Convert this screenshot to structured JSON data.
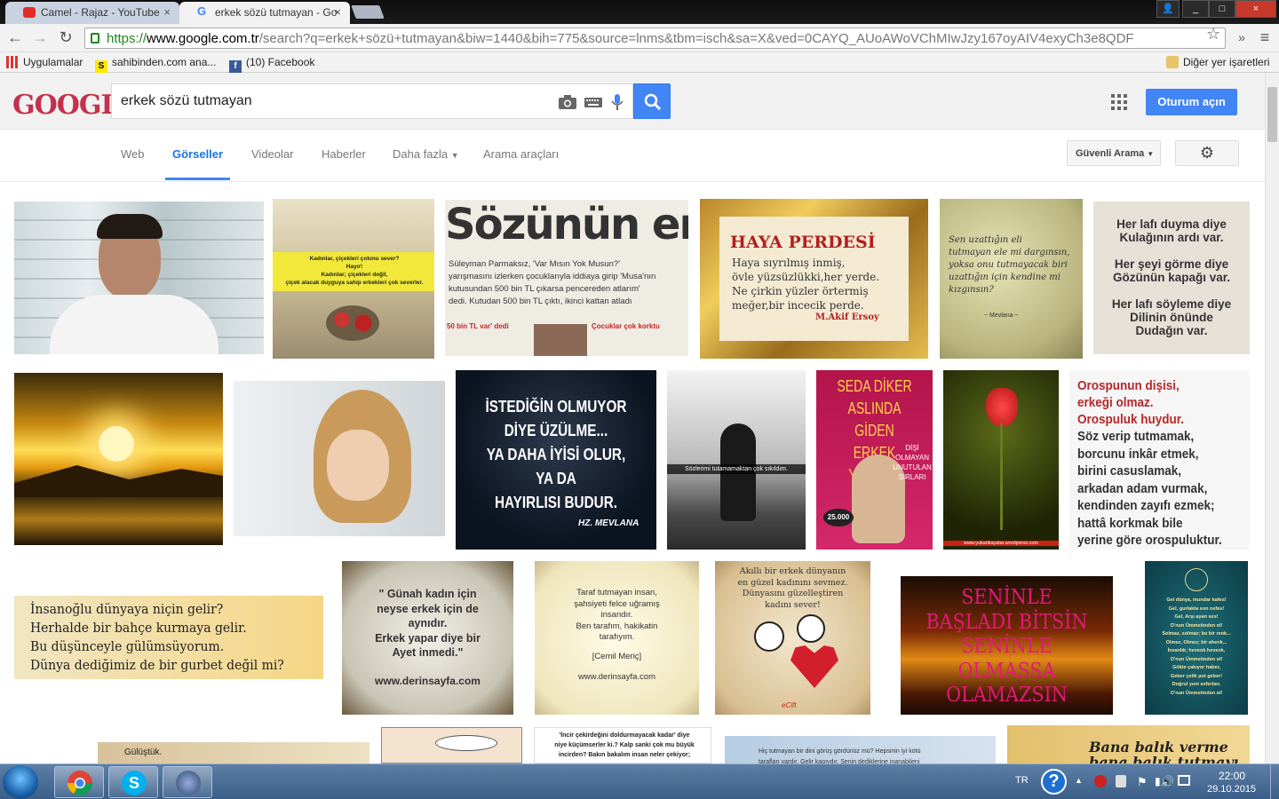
{
  "browser": {
    "tabs": [
      {
        "title": "Camel - Rajaz - YouTube",
        "close": "×"
      },
      {
        "title": "erkek sözü tutmayan - Go",
        "close": "×"
      }
    ],
    "url": {
      "scheme": "https://",
      "host": "www.google.com.tr",
      "rest": "/search?q=erkek+sözü+tutmayan&biw=1440&bih=775&source=lnms&tbm=isch&sa=X&ved=0CAYQ_AUoAWoVChMIwJzy167oyAIV4exyCh3e8QDF"
    },
    "menu_chevrons": "»",
    "menu_icon": "≡",
    "window_controls": {
      "user": "👤",
      "minimize": "_",
      "maximize": "□",
      "close": "×"
    }
  },
  "bookmarks": {
    "items": [
      {
        "label": "Uygulamalar",
        "icon": "apps-grid-icon"
      },
      {
        "label": "sahibinden.com ana...",
        "icon_letter": "S"
      },
      {
        "label": "(10) Facebook",
        "icon_letter": "f"
      }
    ],
    "other": "Diğer yer işaretleri"
  },
  "google": {
    "logo": "GOOGLE",
    "query": "erkek sözü tutmayan",
    "signin": "Oturum açın",
    "tabs": [
      "Web",
      "Görseller",
      "Videolar",
      "Haberler",
      "Daha fazla",
      "Arama araçları"
    ],
    "active_tab": "Görseller",
    "safesearch": "Güvenli Arama"
  },
  "images": {
    "r1": [
      {
        "text": "",
        "kind": "photo-man"
      },
      {
        "text": "Kadınlar, çiçekleri çokmu sever?\nHayır!\nKadınlar; çiçekleri değil,\nçiçek alacak duyguya sahip erkekleri çok severler."
      },
      {
        "text": "Sözünün eri",
        "sub": "Süleyman Parmaksız, 'Var Mısın Yok Musun?'\nyarışmasını izlerken çocuklarıyla iddiaya girip 'Musa'nın\nkutusundan 500 bin TL çıkarsa pencereden atlarım'\ndedi. Kutudan 500 bin TL çıktı, ikinci kattan atladı",
        "foot1": "50 bin TL var' dedi",
        "foot2": "Çocuklar çok korktu"
      },
      {
        "text": "HAYA PERDESİ",
        "sub": "Haya sıyrılmış inmiş,\növle yüzsüzlükki,her yerde.\nNe çirkin yüzler örtermiş\nmeğer,bir incecik perde.",
        "foot1": "M.Akif Ersoy"
      },
      {
        "text": "Sen uzattığın eli\ntutmayan ele mi dargınsın,\nyoksa onu tutmayacak biri\nuzattığın için kendine mi\nkızgınsın?",
        "foot1": "~ Mevlana ~"
      },
      {
        "text": "Her lafı duyma diye\nKulağının ardı var.\n\nHer şeyi görme diye\nGözünün kapağı var.\n\nHer lafı söyleme diye\nDilinin önünde\nDudağın var."
      }
    ],
    "r2": [
      {
        "text": "",
        "kind": "sunset"
      },
      {
        "text": "",
        "kind": "girl"
      },
      {
        "text": "İSTEDİĞİN OLMUYOR\nDİYE ÜZÜLME...\nYA DAHA İYİSİ OLUR,\nYA DA\nHAYIRLISI BUDUR.",
        "foot1": "HZ. MEVLANA"
      },
      {
        "text": "Sözlerimi tutamamaktan çok sıkıldım."
      },
      {
        "text": "SEDA DİKER\nASLINDA GİDEN\nERKEK YOKTUR",
        "sub": "DİŞİ\nOLMAYAN\nUNUTULAN\nSIRLARI",
        "foot1": "25.000"
      },
      {
        "text": "",
        "kind": "tulip",
        "foot1": "www.yukarikayalar.wordpress.com"
      },
      {
        "text": "Orospunun dişisi,\nerkeği olmaz.\nOrospuluk huydur.",
        "sub": "Söz verip tutmamak,\nborcunu inkâr etmek,\nbirini casuslamak,\narkadan adam vurmak,\nkendinden zayıfı ezmek;\nhattâ korkmak bile\nyerine göre orospuluktur."
      }
    ],
    "r3": [
      {
        "text": "İnsanoğlu dünyaya niçin gelir?\nHerhalde bir bahçe kurmaya gelir.\nBu düşünceyle gülümsüyorum.\nDünya dediğimiz de bir gurbet değil mi?"
      },
      {
        "text": "\" Günah kadın için\nneyse erkek için de\naynıdır.\nErkek yapar diye bir\nAyet inmedi.\"",
        "foot1": "www.derinsayfa.com"
      },
      {
        "text": "Taraf tutmayan insan,\nşahsiyeti felce uğramış\ninsandır.\nBen tarafım, hakikatin\ntarafıyım.",
        "sub": "[Cemil Meriç]",
        "foot1": "www.derinsayfa.com"
      },
      {
        "text": "Akıllı bir erkek dünyanın\nen güzel kadınını sevmez.\nDünyasını güzelleştiren\nkadını sever!",
        "foot1": "eCift"
      },
      {
        "text": "SENİNLE\nBAŞLADI BİTSİN\nSENİNLE\nOLMASSA\nOLAMAZSIN"
      },
      {
        "text": "Gel dünya, mundar kafes!\nGel, gurlakta son nefes!\nGel, Arşı ayan ses!\nO'nun Ümmetinden ol!\nSolmaz, solmaz; bu bir renk...\nOlmez, Olmez; bir ahenk...\nİnsanlık; hevenk hevenk,\nO'nun Ümmetinden ol!\nGökte çakıyor haber,\nGeber çelik put geber!\nDoğrul yeni seferber,\nO'nun Ümmetinden ol!"
      }
    ],
    "r4": [
      {
        "text": "Gülüştük."
      },
      {
        "text": ""
      },
      {
        "text": "'İncir çekirdeğini doldurmayacak kadar' diye\nniye küçümserler ki.? Kalp sanki çok mu büyük\nincirden? Bakın bakalım insan neler çekiyor;"
      },
      {
        "text": "Hiç tutmayan bir dini görüş gördünüz mü? Hepsinin iyi kötü\ntarafları vardır. Gelir kapıydır. Senin dediklerine inanabileni"
      },
      {
        "text": "Bana balık verme\nbana balık tutmayı da"
      }
    ]
  },
  "taskbar": {
    "lang": "TR",
    "time": "22:00",
    "date": "29.10.2015",
    "help": "?"
  }
}
